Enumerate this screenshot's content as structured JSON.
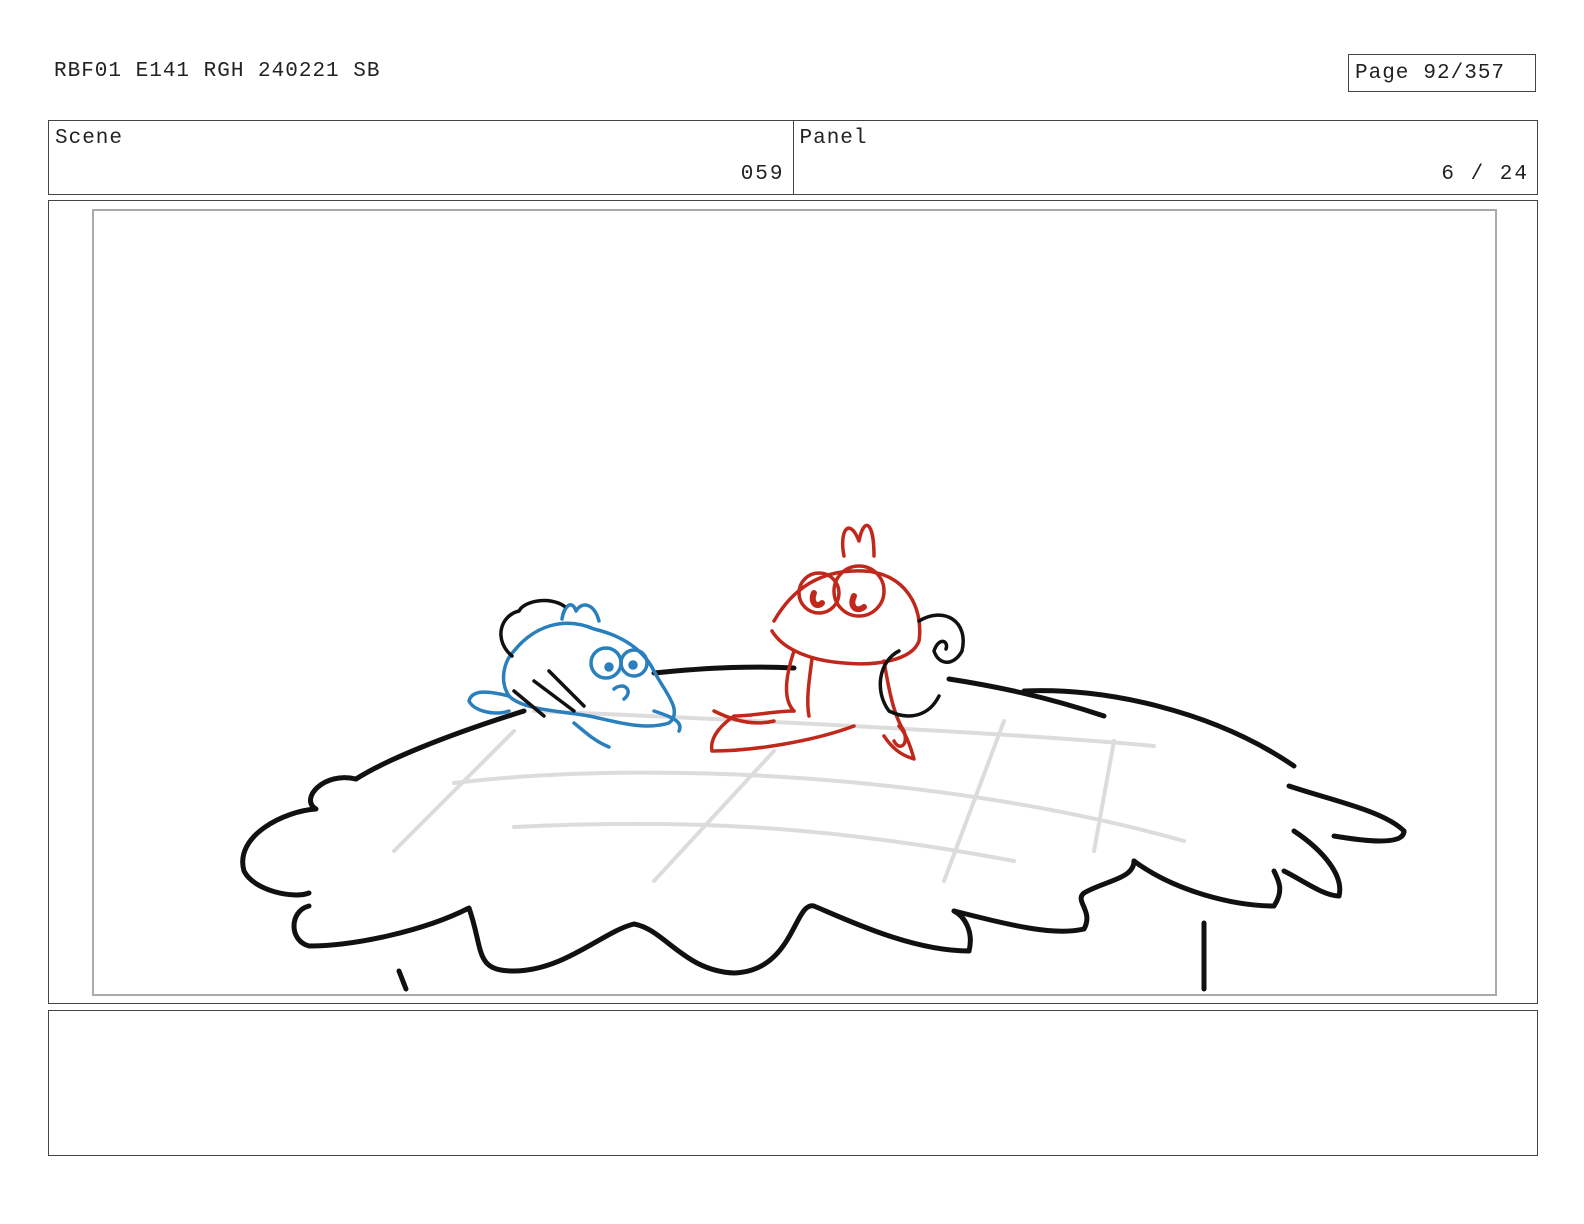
{
  "header": {
    "doc_id": "RBF01 E141 RGH 240221 SB",
    "page_label": "Page",
    "page_value": "92/357"
  },
  "info": {
    "scene_label": "Scene",
    "scene_value": "059",
    "panel_label": "Panel",
    "panel_value": "6 / 24"
  },
  "notes": {
    "text": ""
  },
  "colors": {
    "ink_black": "#111111",
    "ink_blue": "#2a7fbd",
    "ink_red": "#c0281c",
    "guide_gray": "#d9d9d9"
  }
}
